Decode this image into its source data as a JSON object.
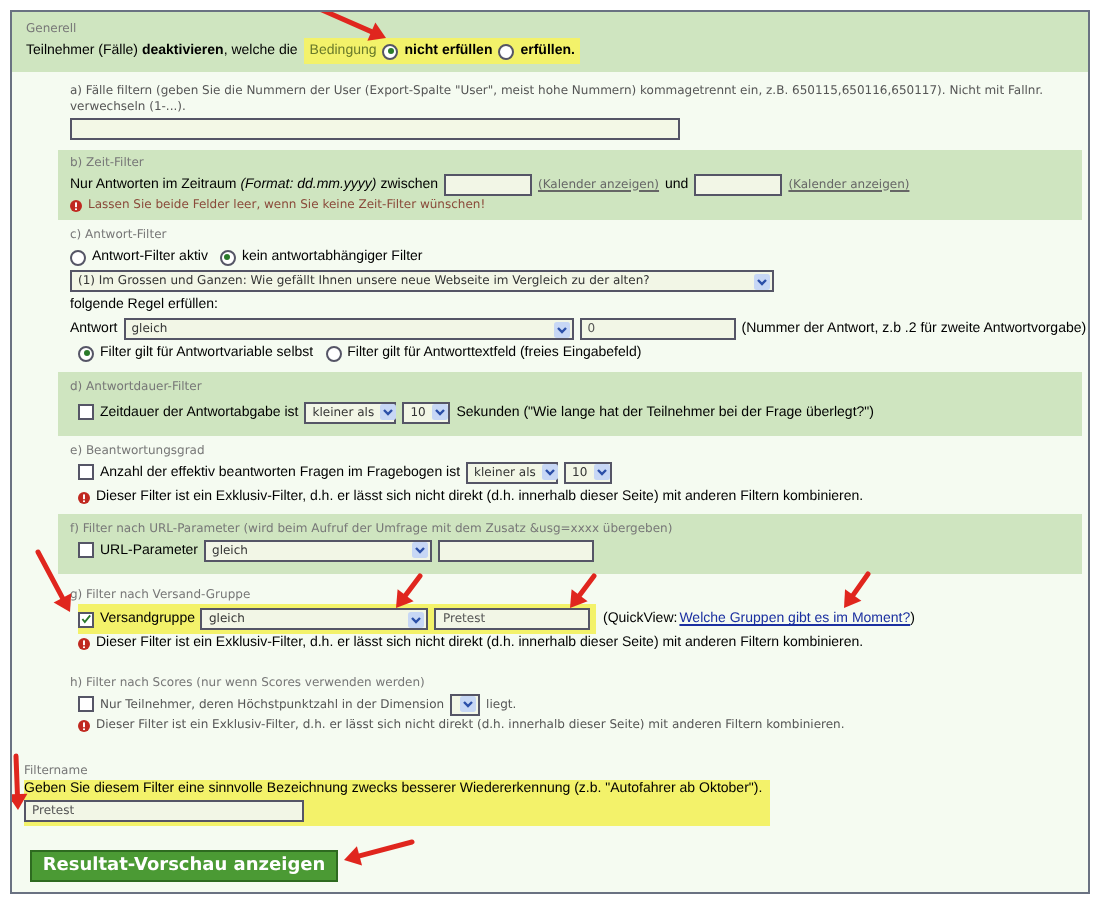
{
  "general": {
    "heading": "Generell",
    "sentence": "Teilnehmer (Fälle) **deaktivieren**, welche die",
    "condition_label": "Bedingung",
    "highlighted": true,
    "options": [
      {
        "label": "nicht erfüllen",
        "selected": true
      },
      {
        "label": "erfüllen.",
        "selected": false
      }
    ]
  },
  "user_filter": {
    "title": "a) Fälle filtern (geben Sie die Nummern der User (Export-Spalte \"User\", meist hohe Nummern) kommagetrennt ein, z.B. 650115,650116,650117). Nicht mit Fallnr. verwechseln (1-...)."
  },
  "time_filter": {
    "title": "b) Zeit-Filter",
    "text": "Nur Antworten im Zeitraum *(Format: dd.mm.yyyy)* zwischen",
    "calendar_link_1": "(Kalender anzeigen)",
    "and": "und",
    "calendar_link_2": "(Kalender anzeigen)",
    "hint": "Lassen Sie beide Felder leer, wenn Sie keine Zeit-Filter wünschen!"
  },
  "answer_filter": {
    "title": "c) Antwort-Filter",
    "modes": [
      {
        "label": "Antwort-Filter aktiv",
        "selected": false
      },
      {
        "label": "kein antwortabhängiger Filter",
        "selected": true
      }
    ],
    "question": "(1) Im Grossen und Ganzen: Wie gefällt Ihnen unsere neue Webseite im Vergleich zu der alten?",
    "rule_label": "folgende Regel erfüllen:",
    "answer_label": "Antwort",
    "operator": "gleich",
    "answer_value": "0",
    "answer_hint": "(Nummer der Antwort, z.b .2 für zweite Antwortvorgabe)",
    "targets": [
      {
        "label": "Filter gilt für Antwortvariable selbst",
        "selected": true
      },
      {
        "label": "Filter gilt für Antworttextfeld (freies Eingabefeld)",
        "selected": false
      }
    ]
  },
  "duration_filter": {
    "title": "d) Antwortdauer-Filter",
    "checked": false,
    "label": "Zeitdauer der Antwortabgabe ist",
    "operator": "kleiner als",
    "value": "10",
    "suffix": "Sekunden (\"Wie lange hat der Teilnehmer bei der Frage überlegt?\")"
  },
  "completion_filter": {
    "title": "e) Beantwortungsgrad",
    "checked": false,
    "label": "Anzahl der effektiv beantworten Fragen im Fragebogen ist",
    "operator": "kleiner als",
    "value": "10",
    "warning": "Dieser Filter ist ein Exklusiv-Filter, d.h. er lässt sich nicht direkt (d.h. innerhalb dieser Seite) mit anderen Filtern kombinieren."
  },
  "url_filter": {
    "title": "f) Filter nach URL-Parameter (wird beim Aufruf der Umfrage mit dem Zusatz &usg=xxxx übergeben)",
    "checked": false,
    "label": "URL-Parameter",
    "operator": "gleich"
  },
  "group_filter": {
    "title": "g) Filter nach Versand-Gruppe",
    "checked": true,
    "highlighted": true,
    "label": "Versandgruppe",
    "operator": "gleich",
    "value": "Pretest",
    "quickview": "(QuickView:",
    "link": "Welche Gruppen gibt es im Moment?",
    "close": ")",
    "warning": "Dieser Filter ist ein Exklusiv-Filter, d.h. er lässt sich nicht direkt (d.h. innerhalb dieser Seite) mit anderen Filtern kombinieren."
  },
  "score_filter": {
    "title": "h) Filter nach Scores (nur wenn Scores verwenden werden)",
    "checked": false,
    "label": "Nur Teilnehmer, deren Höchstpunktzahl in der Dimension",
    "suffix": "liegt.",
    "warning": "Dieser Filter ist ein Exklusiv-Filter, d.h. er lässt sich nicht direkt (d.h. innerhalb dieser Seite) mit anderen Filtern kombinieren."
  },
  "filter_name": {
    "heading": "Filtername",
    "hint": "Geben Sie diesem Filter eine sinnvolle Bezeichnung zwecks besserer Wiedererkennung (z.b. \"Autofahrer ab Oktober\").",
    "value": "Pretest",
    "highlighted": true
  },
  "submit": "Resultat-Vorschau anzeigen"
}
